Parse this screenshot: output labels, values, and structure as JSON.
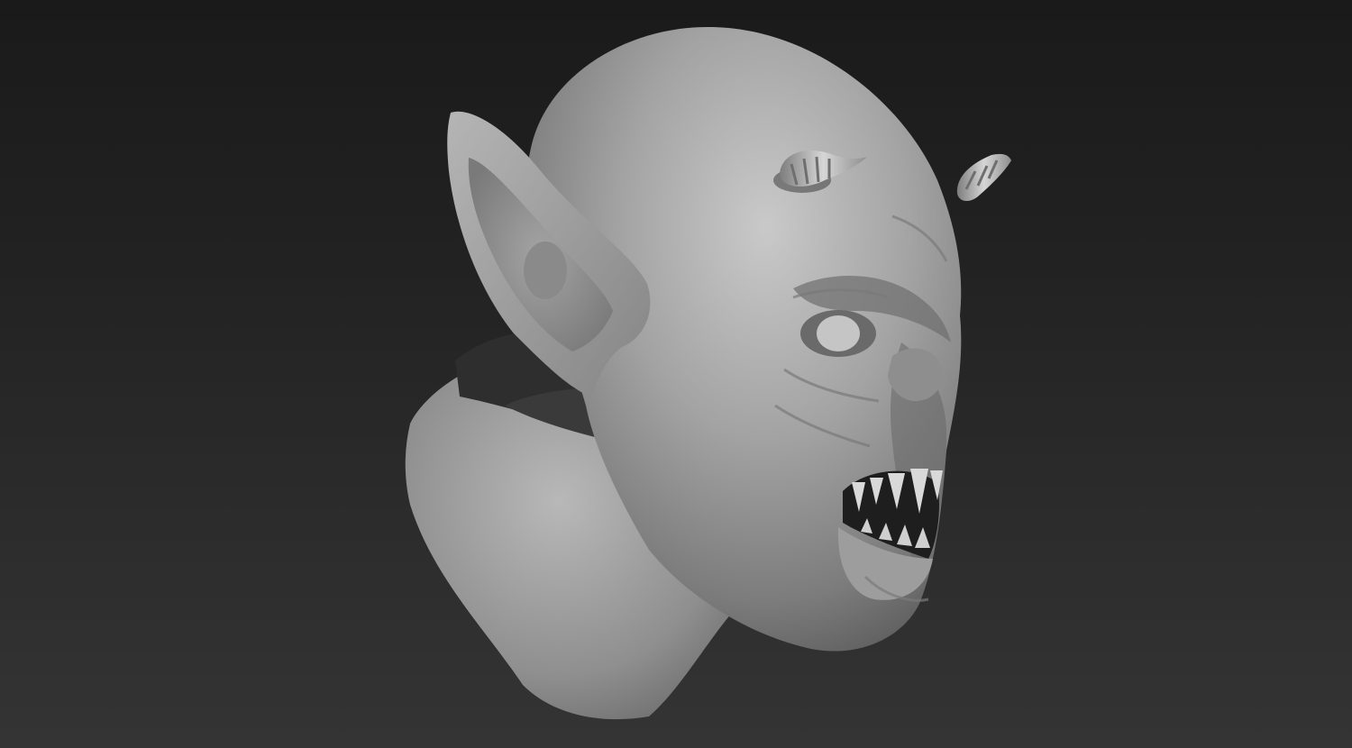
{
  "scene": {
    "subject": "sculpt-render",
    "background_top": "#1a1a1a",
    "background_bottom": "#343434",
    "clay_color": "#9a9a9a",
    "clay_highlight": "#c8c8c8",
    "clay_shadow": "#3a3a3a"
  }
}
